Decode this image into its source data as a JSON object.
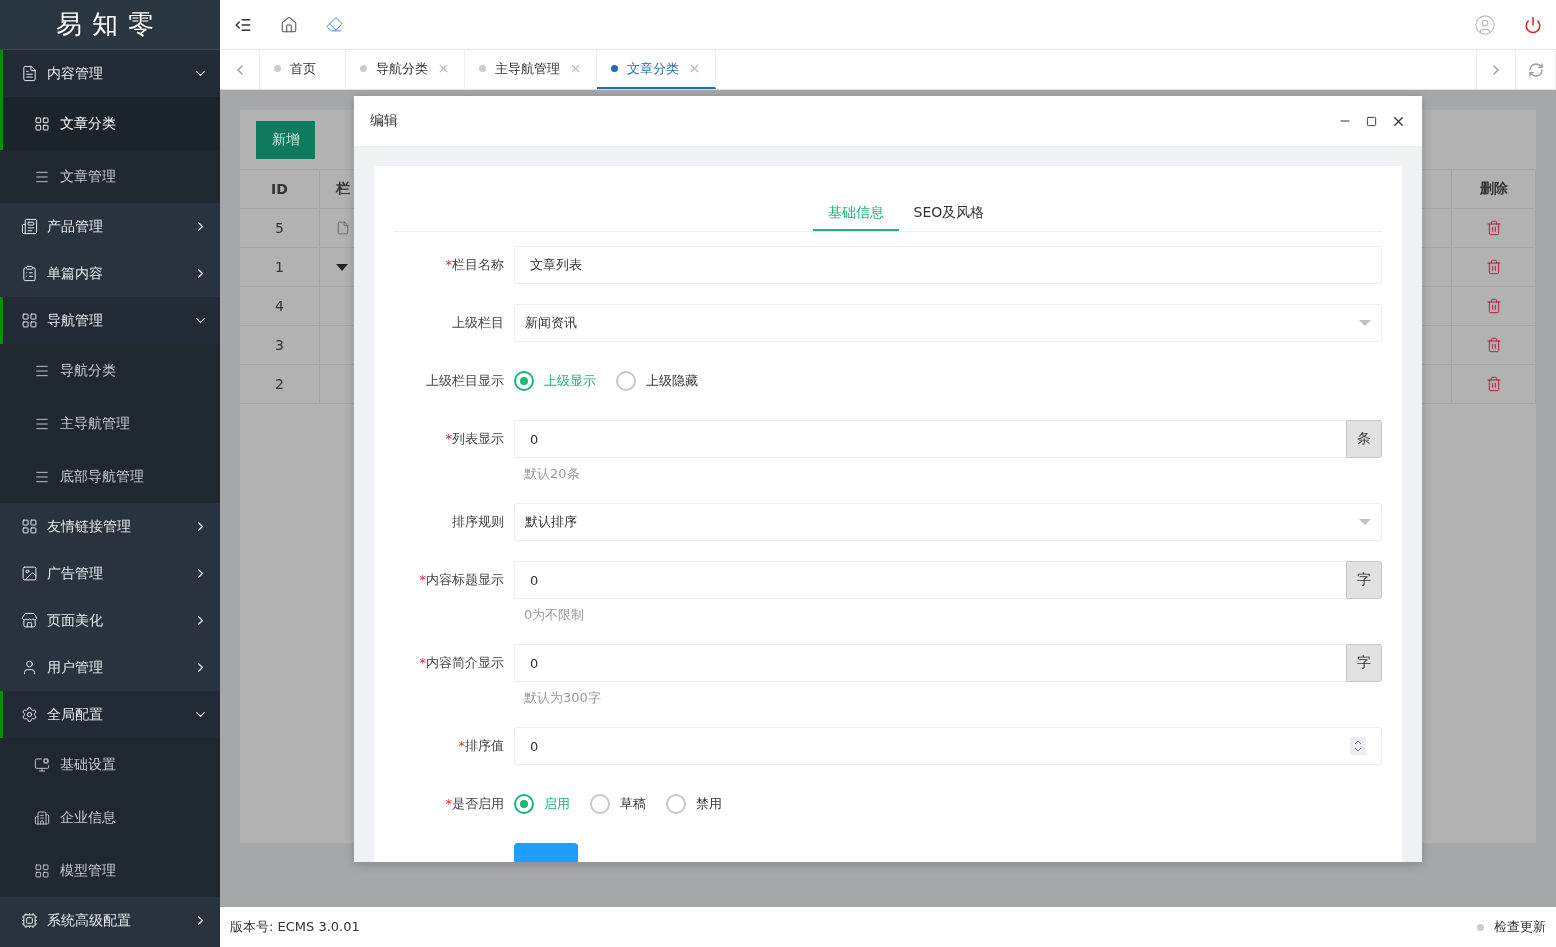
{
  "logo": "易知零",
  "sidebar": [
    {
      "label": "内容管理",
      "expanded": true,
      "children": [
        {
          "label": "文章分类",
          "selected": true
        },
        {
          "label": "文章管理",
          "selected": false
        }
      ]
    },
    {
      "label": "产品管理",
      "expanded": false
    },
    {
      "label": "单篇内容",
      "expanded": false
    },
    {
      "label": "导航管理",
      "expanded": true,
      "children": [
        {
          "label": "导航分类",
          "selected": false
        },
        {
          "label": "主导航管理",
          "selected": false
        },
        {
          "label": "底部导航管理",
          "selected": false
        }
      ]
    },
    {
      "label": "友情链接管理",
      "expanded": false
    },
    {
      "label": "广告管理",
      "expanded": false
    },
    {
      "label": "页面美化",
      "expanded": false
    },
    {
      "label": "用户管理",
      "expanded": false
    },
    {
      "label": "全局配置",
      "expanded": true,
      "children": [
        {
          "label": "基础设置",
          "selected": false
        },
        {
          "label": "企业信息",
          "selected": false
        },
        {
          "label": "模型管理",
          "selected": false
        }
      ]
    },
    {
      "label": "系统高级配置",
      "expanded": false
    }
  ],
  "tabs": [
    {
      "label": "首页",
      "selected": false,
      "closable": false
    },
    {
      "label": "导航分类",
      "selected": false,
      "closable": true
    },
    {
      "label": "主导航管理",
      "selected": false,
      "closable": true
    },
    {
      "label": "文章分类",
      "selected": true,
      "closable": true
    }
  ],
  "add_button": "新增",
  "table": {
    "columns": [
      "ID",
      "栏"
    ],
    "last_column": "删除",
    "rows": [
      {
        "id": "5",
        "kind": "file"
      },
      {
        "id": "1",
        "kind": "branch"
      },
      {
        "id": "4",
        "kind": "plain"
      },
      {
        "id": "3",
        "kind": "plain"
      },
      {
        "id": "2",
        "kind": "plain"
      }
    ]
  },
  "modal": {
    "title": "编辑",
    "tabs": [
      {
        "label": "基础信息",
        "selected": true
      },
      {
        "label": "SEO及风格",
        "selected": false
      }
    ],
    "fields": [
      {
        "kind": "text",
        "required_mark": "*",
        "label": "栏目名称",
        "value": "文章列表"
      },
      {
        "kind": "select",
        "label": "上级栏目",
        "value": "新闻资讯"
      },
      {
        "kind": "radio",
        "label": "上级栏目显示",
        "options": [
          {
            "label": "上级显示",
            "selected": true
          },
          {
            "label": "上级隐藏",
            "selected": false
          }
        ]
      },
      {
        "kind": "addon",
        "required_mark": "*",
        "label": "列表显示",
        "value": "0",
        "addon": "条",
        "hint": "默认20条"
      },
      {
        "kind": "select",
        "label": "排序规则",
        "value": "默认排序"
      },
      {
        "kind": "addon",
        "required_mark": "*",
        "label": "内容标题显示",
        "value": "0",
        "addon": "字",
        "hint": "0为不限制"
      },
      {
        "kind": "addon",
        "required_mark": "*",
        "label": "内容简介显示",
        "value": "0",
        "addon": "字",
        "hint": "默认为300字"
      },
      {
        "kind": "number",
        "required_mark": "*",
        "label": "排序值",
        "value": "0"
      },
      {
        "kind": "radio",
        "required_mark": "*",
        "label": "是否启用",
        "options": [
          {
            "label": "启用",
            "selected": true
          },
          {
            "label": "草稿",
            "selected": false
          },
          {
            "label": "禁用",
            "selected": false
          }
        ]
      }
    ]
  },
  "footer": {
    "version": "版本号: ECMS 3.0.01",
    "update": "检查更新"
  }
}
